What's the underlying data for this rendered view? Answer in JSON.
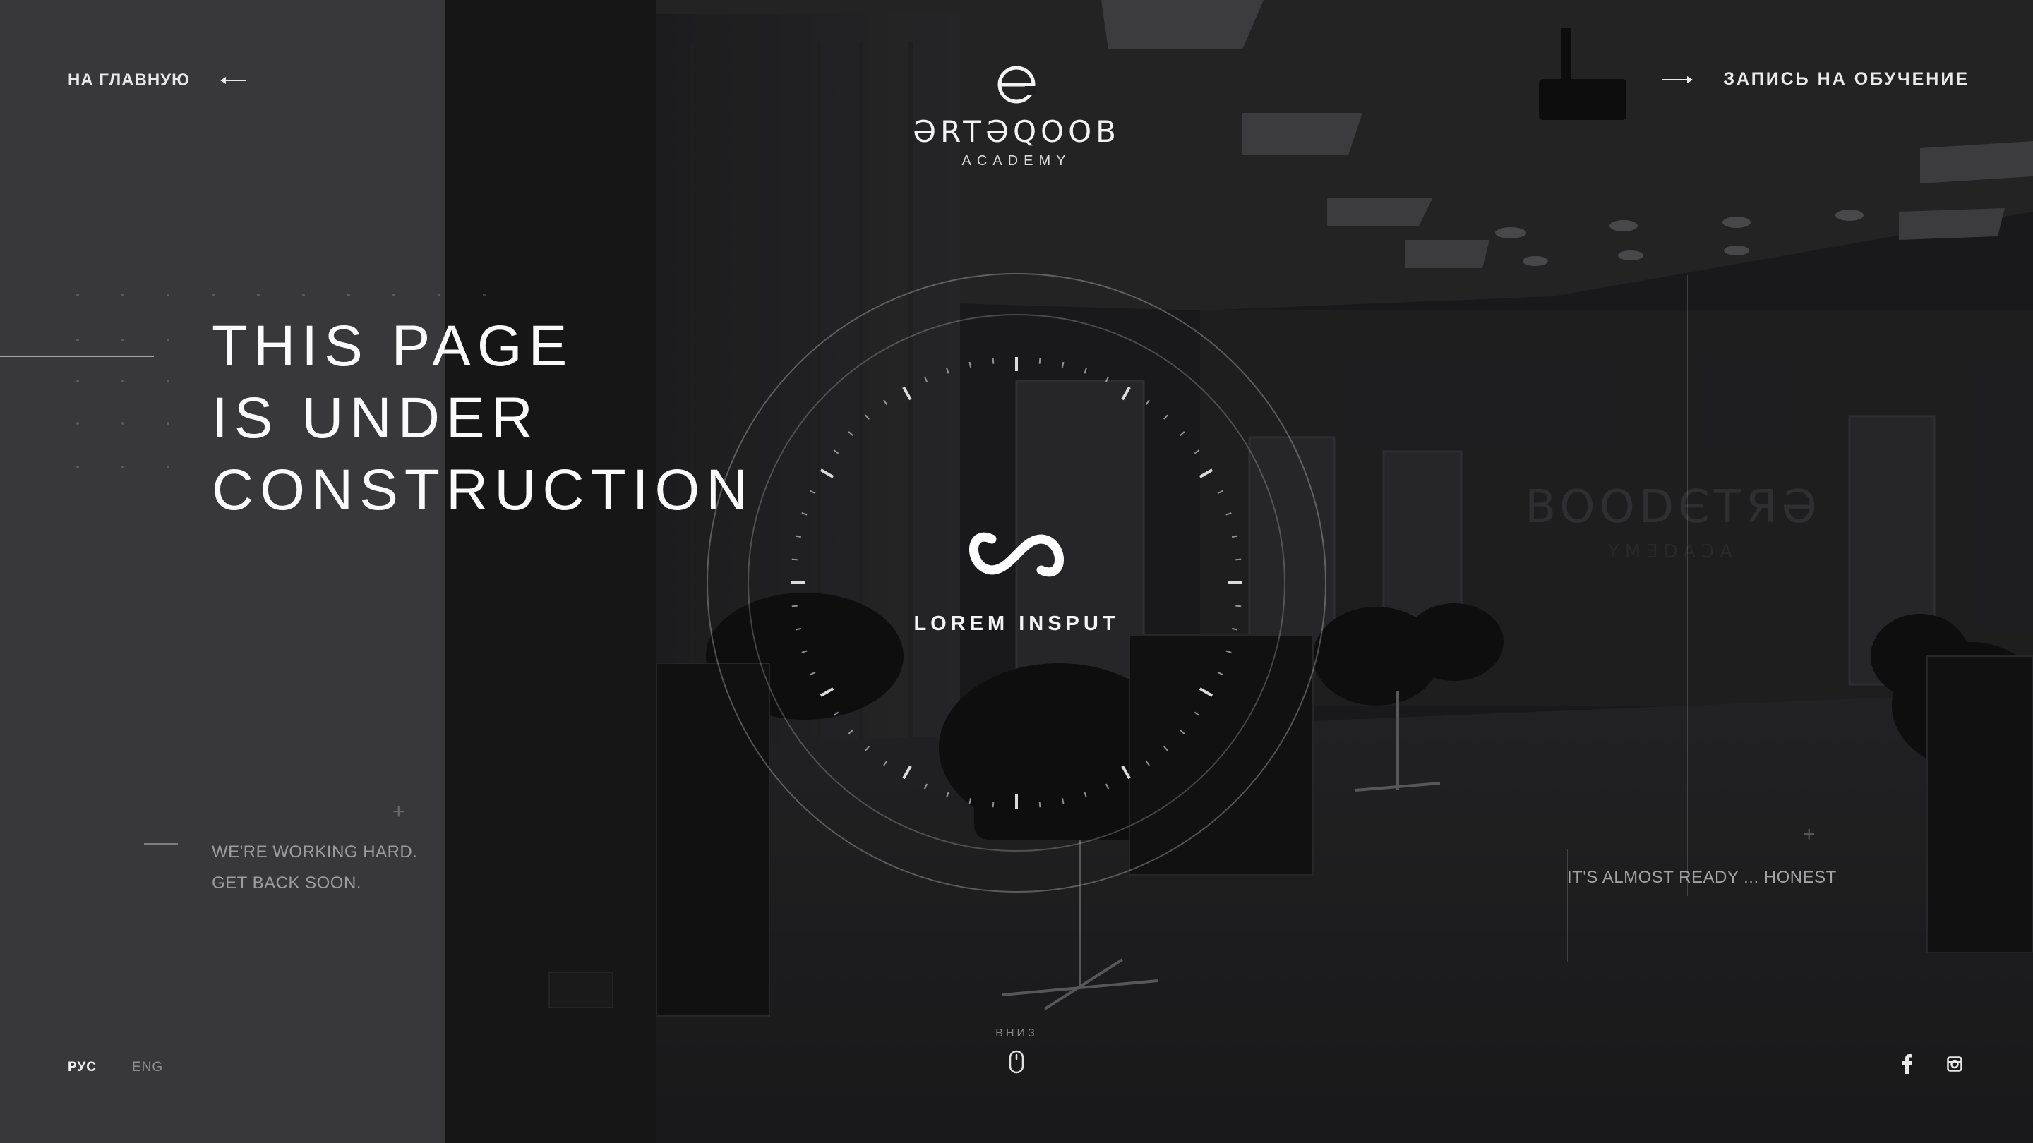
{
  "header": {
    "home_link": "НА ГЛАВНУЮ",
    "enroll_link": "ЗАПИСЬ НА ОБУЧЕНИЕ",
    "logo_word": "ƏRTƏQOOB",
    "logo_sub": "ACADEMY"
  },
  "hero": {
    "line1": "THIS PAGE",
    "line2": "IS UNDER",
    "line3": "CONSTRUCTION",
    "center_label": "LOREM INSPUT"
  },
  "footer": {
    "working_line1": "WE'RE WORKING HARD.",
    "working_line2": "GET BACK SOON.",
    "ready_text": "IT'S ALMOST READY ... HONEST",
    "scroll_label": "ВНИЗ",
    "lang_ru": "РУС",
    "lang_en": "ENG"
  },
  "icons": {
    "logo": "logo-mark-icon",
    "infinity": "infinity-icon",
    "mouse": "mouse-icon",
    "facebook": "facebook-icon",
    "instagram": "instagram-icon"
  },
  "colors": {
    "panel": "#38383a",
    "background": "#1c1c1d",
    "text": "#fafafa",
    "muted": "#9d9d9f"
  }
}
